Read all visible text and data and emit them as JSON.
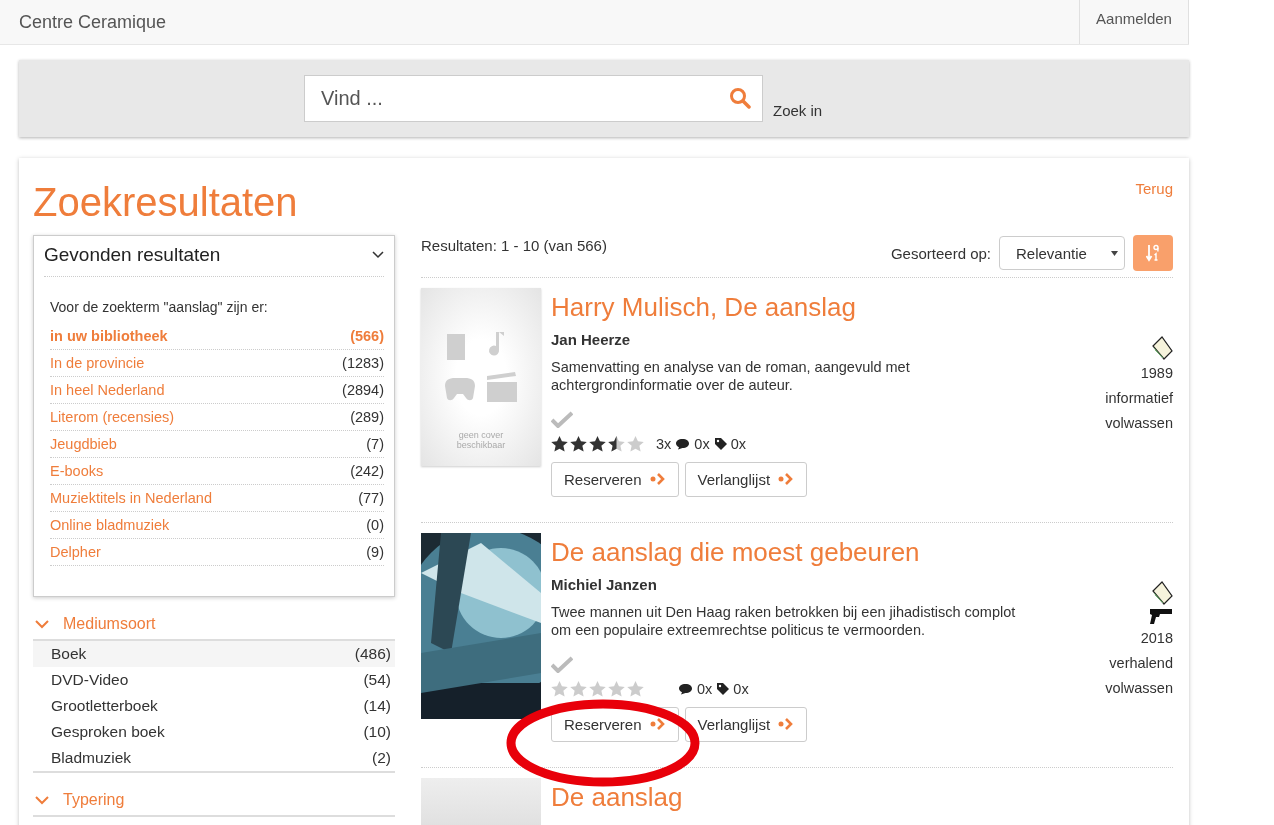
{
  "header": {
    "brand": "Centre Ceramique",
    "login": "Aanmelden"
  },
  "search": {
    "placeholder": "Vind ...",
    "scope_label": "Zoek in"
  },
  "page": {
    "title": "Zoekresultaten",
    "back_link": "Terug"
  },
  "found_panel": {
    "title": "Gevonden resultaten",
    "intro": "Voor de zoekterm \"aanslag\" zijn er:",
    "items": [
      {
        "label": "in uw bibliotheek",
        "count": "(566)",
        "selected": true
      },
      {
        "label": "In de provincie",
        "count": "(1283)",
        "selected": false
      },
      {
        "label": "In heel Nederland",
        "count": "(2894)",
        "selected": false
      },
      {
        "label": "Literom (recensies)",
        "count": "(289)",
        "selected": false
      },
      {
        "label": "Jeugdbieb",
        "count": "(7)",
        "selected": false
      },
      {
        "label": "E-books",
        "count": "(242)",
        "selected": false
      },
      {
        "label": "Muziektitels in Nederland",
        "count": "(77)",
        "selected": false
      },
      {
        "label": "Online bladmuziek",
        "count": "(0)",
        "selected": false
      },
      {
        "label": "Delpher",
        "count": "(9)",
        "selected": false
      }
    ]
  },
  "facets": [
    {
      "title": "Mediumsoort",
      "expanded": true,
      "items": [
        {
          "label": "Boek",
          "count": "(486)",
          "selected": true
        },
        {
          "label": "DVD-Video",
          "count": "(54)",
          "selected": false
        },
        {
          "label": "Grootletterboek",
          "count": "(14)",
          "selected": false
        },
        {
          "label": "Gesproken boek",
          "count": "(10)",
          "selected": false
        },
        {
          "label": "Bladmuziek",
          "count": "(2)",
          "selected": false
        }
      ]
    },
    {
      "title": "Typering",
      "expanded": true
    }
  ],
  "results_bar": {
    "summary": "Resultaten: 1 - 10 (van 566)",
    "sort_label": "Gesorteerd op:",
    "sort_value": "Relevantie"
  },
  "results": [
    {
      "cover": {
        "kind": "placeholder",
        "text": "geen cover beschikbaar"
      },
      "title": "Harry Mulisch, De aanslag",
      "author": "Jan Heerze",
      "description": "Samenvatting en analyse van de roman, aangevuld met achtergrondinformatie over de auteur.",
      "stars": 3.5,
      "rating_count": "3x",
      "reviews": "0x",
      "tags": "0x",
      "buttons": [
        "Reserveren",
        "Verlanglijst"
      ],
      "media": [
        {
          "kind": "book"
        }
      ],
      "year": "1989",
      "genre": "informatief",
      "audience": "volwassen"
    },
    {
      "cover": {
        "kind": "picture"
      },
      "title": "De aanslag die moest gebeuren",
      "author": "Michiel Janzen",
      "description": "Twee mannen uit Den Haag raken betrokken bij een jihadistisch complot om een populaire extreemrechtse politicus te vermoorden.",
      "stars": 0,
      "reviews": "0x",
      "tags": "0x",
      "buttons": [
        "Reserveren",
        "Verlanglijst"
      ],
      "media": [
        {
          "kind": "book"
        },
        {
          "kind": "gun"
        }
      ],
      "year": "2018",
      "genre": "verhalend",
      "audience": "volwassen"
    },
    {
      "cover": {
        "kind": "blank"
      },
      "title": "De aanslag"
    }
  ],
  "annotation": {
    "kind": "ellipse"
  }
}
